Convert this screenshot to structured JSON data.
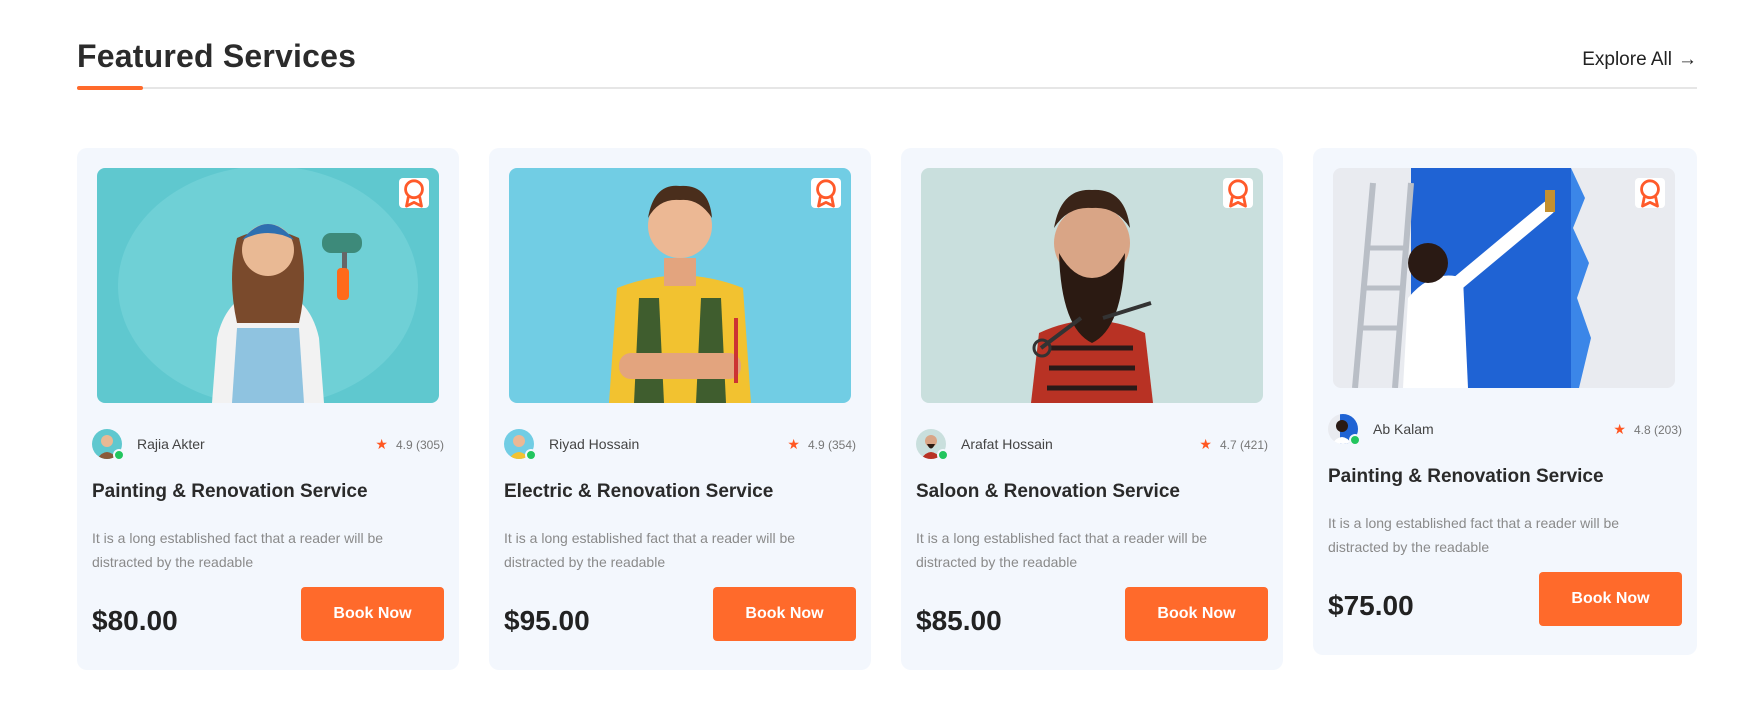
{
  "section": {
    "title": "Featured Services",
    "explore_label": "Explore All",
    "explore_arrow": "→",
    "accent_color": "#ff6a2b"
  },
  "cards": [
    {
      "author": "Rajia Akter",
      "rating": "4.9 (305)",
      "title": "Painting & Renovation Service",
      "description": "It is a long established fact that a reader will be distracted by the readable",
      "price": "$80.00",
      "button": "Book Now",
      "image": "woman-with-paint-roller"
    },
    {
      "author": "Riyad Hossain",
      "rating": "4.9 (354)",
      "title": "Electric & Renovation Service",
      "description": "It is a long established fact that a reader will be distracted by the readable",
      "price": "$95.00",
      "button": "Book Now",
      "image": "electrician-with-tools"
    },
    {
      "author": "Arafat Hossain",
      "rating": "4.7 (421)",
      "title": "Saloon & Renovation Service",
      "description": "It is a long established fact that a reader will be distracted by the readable",
      "price": "$85.00",
      "button": "Book Now",
      "image": "bearded-barber-with-scissors"
    },
    {
      "author": "Ab Kalam",
      "rating": "4.8 (203)",
      "title": "Painting & Renovation Service",
      "description": "It is a long established fact that a reader will be distracted by the readable",
      "price": "$75.00",
      "button": "Book Now",
      "image": "man-painting-wall-blue"
    }
  ]
}
